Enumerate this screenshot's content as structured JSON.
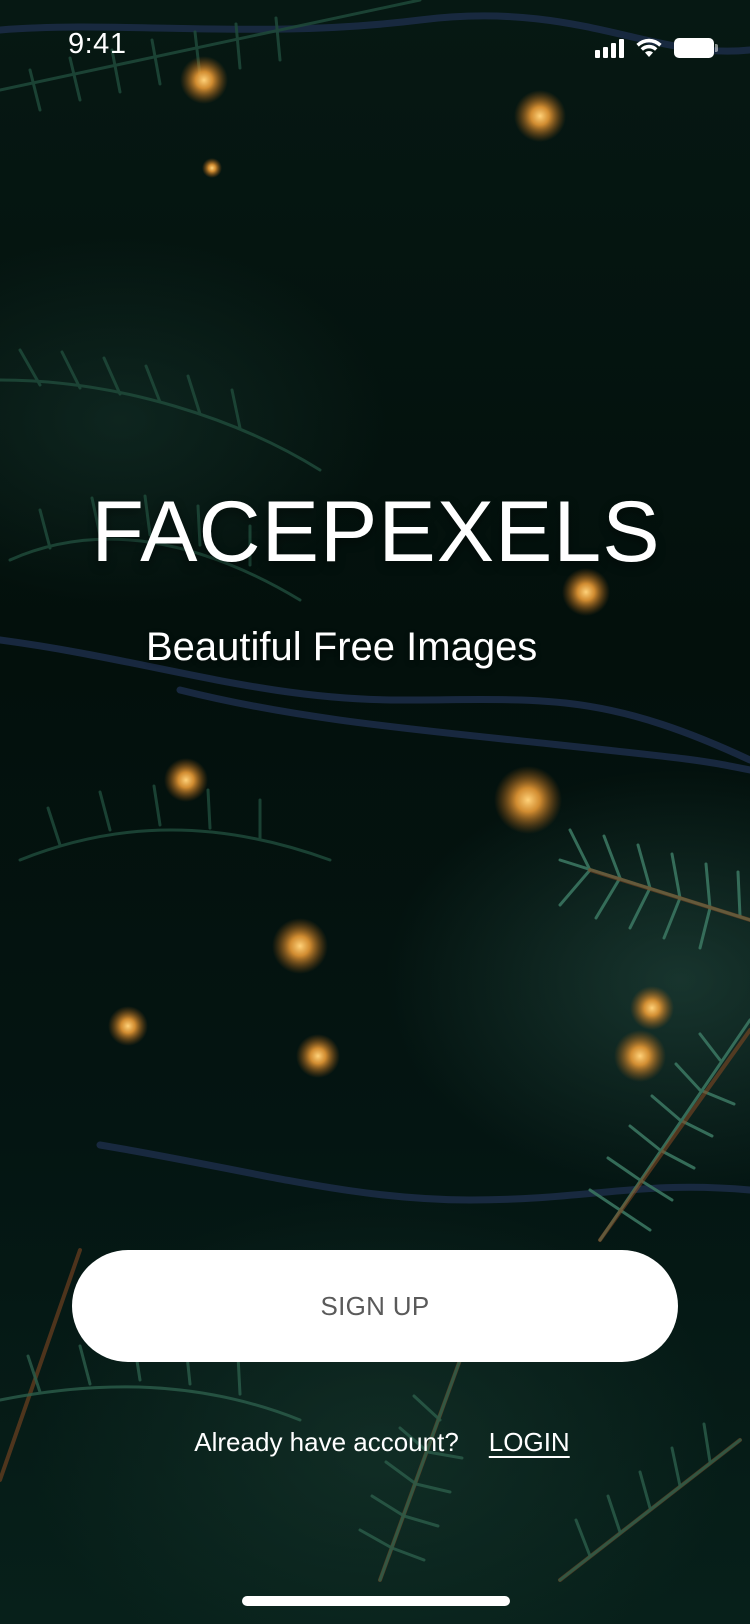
{
  "status_bar": {
    "time": "9:41",
    "icons": [
      "signal-icon",
      "wifi-icon",
      "battery-icon"
    ]
  },
  "hero": {
    "title": "FACEPEXELS",
    "subtitle": "Beautiful Free Images"
  },
  "actions": {
    "signup_label": "SIGN UP",
    "login_prompt": "Already have account?",
    "login_label": "LOGIN"
  },
  "colors": {
    "text": "#ffffff",
    "button_bg": "#ffffff",
    "button_text": "#5a5a5a",
    "background": "#04100d"
  }
}
